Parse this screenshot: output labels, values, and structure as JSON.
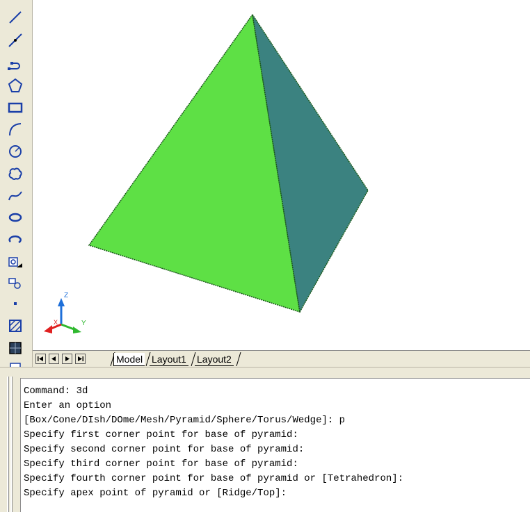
{
  "toolbar": {
    "tools": [
      {
        "icon": "line-icon"
      },
      {
        "icon": "construction-line-icon"
      },
      {
        "icon": "polyline-icon"
      },
      {
        "icon": "polygon-icon"
      },
      {
        "icon": "rectangle-icon"
      },
      {
        "icon": "arc-icon"
      },
      {
        "icon": "circle-icon"
      },
      {
        "icon": "revision-cloud-icon"
      },
      {
        "icon": "spline-icon"
      },
      {
        "icon": "ellipse-icon"
      },
      {
        "icon": "ellipse-arc-icon"
      },
      {
        "icon": "insert-block-icon"
      },
      {
        "icon": "make-block-icon"
      },
      {
        "icon": "point-icon"
      },
      {
        "icon": "hatch-icon"
      },
      {
        "icon": "gradient-icon"
      }
    ]
  },
  "viewport": {
    "ucs_axes": {
      "z": "Z",
      "y": "Y",
      "x": "X"
    },
    "colors": {
      "face_front": "#5ee045",
      "face_side": "#3b8280",
      "edge": "#1a5a1a",
      "axis_z": "#1e6fd9",
      "axis_y": "#2fb82f",
      "axis_x": "#e02020"
    }
  },
  "tabs": {
    "nav": [
      "first",
      "previous",
      "next",
      "last"
    ],
    "items": [
      {
        "label": "Model",
        "active": true
      },
      {
        "label": "Layout1",
        "active": false
      },
      {
        "label": "Layout2",
        "active": false
      }
    ]
  },
  "command": {
    "lines": [
      "Command: 3d",
      "Enter an option",
      "[Box/Cone/DIsh/DOme/Mesh/Pyramid/Sphere/Torus/Wedge]: p",
      "Specify first corner point for base of pyramid:",
      "Specify second corner point for base of pyramid:",
      "Specify third corner point for base of pyramid:",
      "Specify fourth corner point for base of pyramid or [Tetrahedron]:",
      "Specify apex point of pyramid or [Ridge/Top]:"
    ]
  }
}
